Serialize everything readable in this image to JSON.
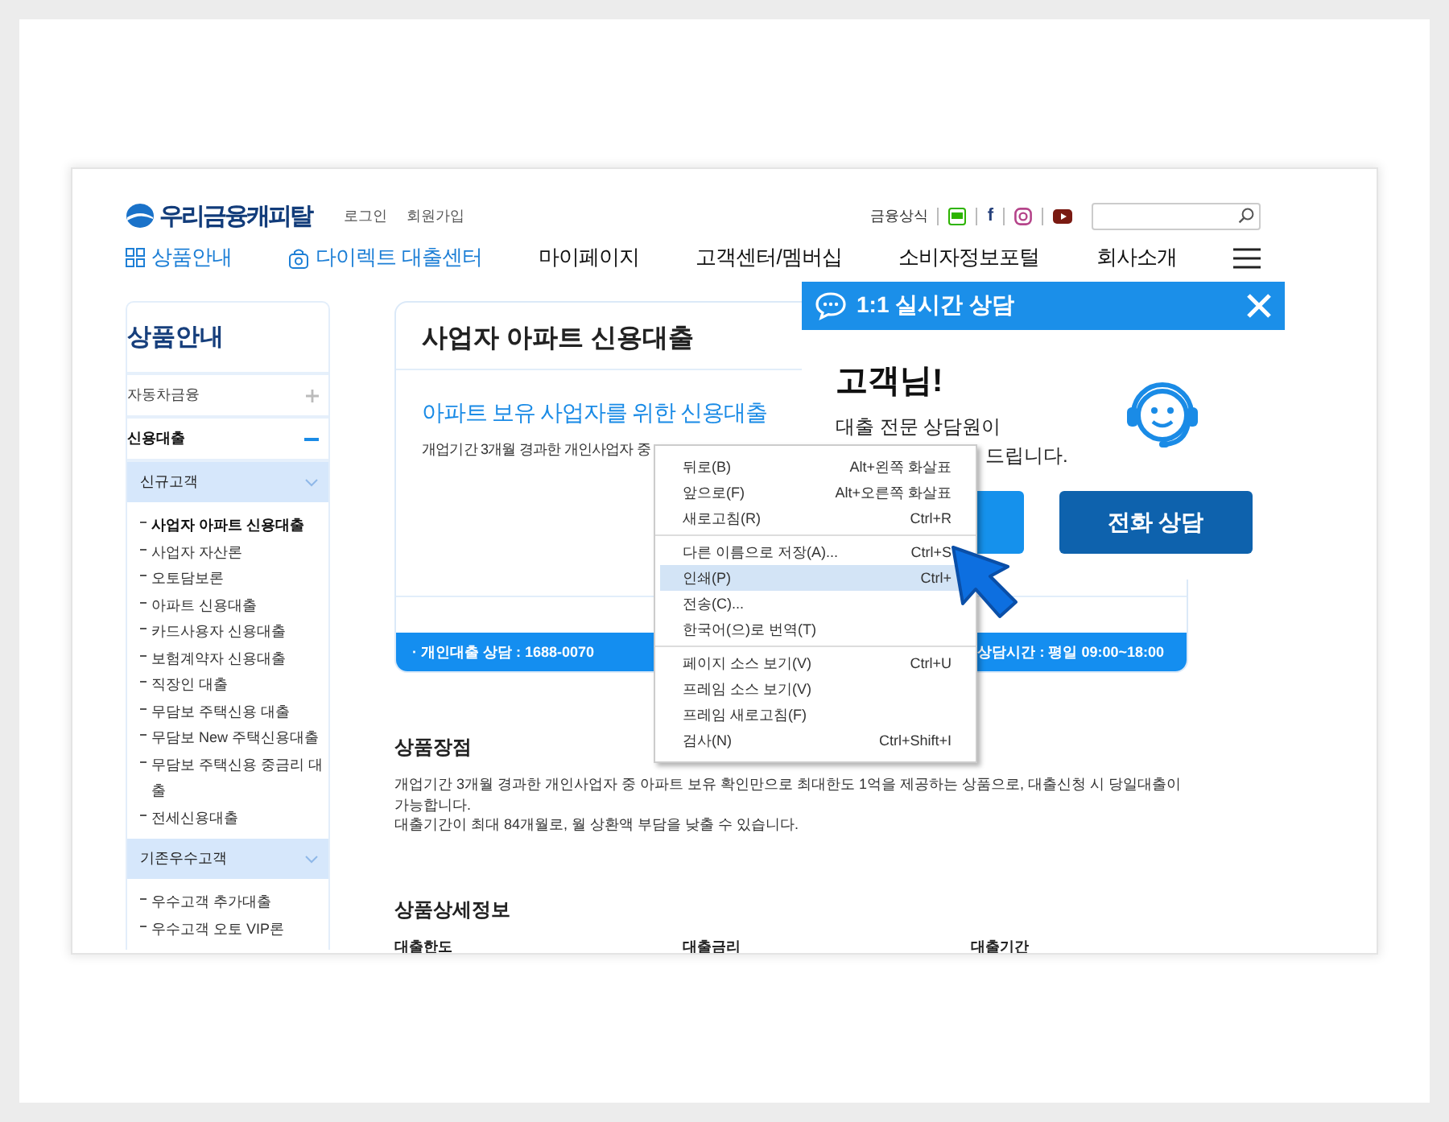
{
  "header": {
    "logo": "우리금융캐피탈",
    "links": [
      "로그인",
      "회원가입"
    ],
    "util_label": "금융상식",
    "social": [
      {
        "kind": "blog"
      },
      {
        "kind": "facebook",
        "glyph": "f"
      },
      {
        "kind": "instagram"
      },
      {
        "kind": "youtube"
      }
    ]
  },
  "nav": [
    {
      "label": "상품안내",
      "kind": "grid"
    },
    {
      "label": "다이렉트 대출센터",
      "kind": "bag"
    },
    {
      "label": "마이페이지",
      "kind": "plain"
    },
    {
      "label": "고객센터/멤버십",
      "kind": "plain"
    },
    {
      "label": "소비자정보포털",
      "kind": "plain"
    },
    {
      "label": "회사소개",
      "kind": "plain"
    }
  ],
  "sidebar": {
    "title": "상품안내",
    "groups": [
      {
        "label": "자동차금융",
        "expanded": false
      },
      {
        "label": "신용대출",
        "expanded": true,
        "children": [
          {
            "label": "신규고객",
            "expanded": true,
            "children": [
              {
                "label": "사업자 아파트 신용대출",
                "selected": true
              },
              {
                "label": "사업자 자산론",
                "selected": false
              },
              {
                "label": "오토담보론",
                "selected": false
              },
              {
                "label": "아파트 신용대출",
                "selected": false
              },
              {
                "label": "카드사용자 신용대출",
                "selected": false
              },
              {
                "label": "보험계약자 신용대출",
                "selected": false
              },
              {
                "label": "직장인 대출",
                "selected": false
              },
              {
                "label": "무담보 주택신용 대출",
                "selected": false
              },
              {
                "label": "무담보 New 주택신용대출",
                "selected": false
              },
              {
                "label": "무담보 주택신용 중금리 대출",
                "selected": false
              },
              {
                "label": "전세신용대출",
                "selected": false
              }
            ]
          },
          {
            "label": "기존우수고객",
            "expanded": true,
            "children": [
              {
                "label": "우수고객 추가대출",
                "selected": false
              },
              {
                "label": "우수고객 오토 VIP론",
                "selected": false
              }
            ]
          }
        ]
      }
    ]
  },
  "product": {
    "title": "사업자 아파트 신용대출",
    "subtitle": "아파트 보유 사업자를 위한 신용대출",
    "description": "개업기간 3개월 경과한 개인사업자 중",
    "footer_left": "· 개인대출 상담 : 1688-0070",
    "footer_right": "상담시간 : 평일 09:00~18:00"
  },
  "sections": [
    {
      "heading": "상품장점",
      "paragraphs": [
        "개업기간 3개월 경과한 개인사업자 중 아파트 보유 확인만으로 최대한도 1억을 제공하는 상품으로, 대출신청 시 당일대출이 가능합니다.",
        "대출기간이 최대 84개월로, 월 상환액 부담을 낮출 수 있습니다."
      ]
    },
    {
      "heading": "상품상세정보",
      "columns": [
        "대출한도",
        "대출금리",
        "대출기간"
      ]
    }
  ],
  "chat": {
    "title": "1:1 실시간 상담",
    "greeting": "고객님!",
    "lines": [
      "대출 전문 상담원이",
      "드립니다."
    ],
    "buttons": [
      {
        "kind": "chat"
      },
      {
        "kind": "phone",
        "label": "전화 상담"
      }
    ]
  },
  "context_menu": {
    "groups": [
      [
        {
          "label": "뒤로(B)",
          "shortcut": "Alt+왼쪽 화살표",
          "selected": false
        },
        {
          "label": "앞으로(F)",
          "shortcut": "Alt+오른쪽 화살표",
          "selected": false
        },
        {
          "label": "새로고침(R)",
          "shortcut": "Ctrl+R",
          "selected": false
        }
      ],
      [
        {
          "label": "다른 이름으로 저장(A)...",
          "shortcut": "Ctrl+S",
          "selected": false
        },
        {
          "label": "인쇄(P)",
          "shortcut": "Ctrl+",
          "selected": true
        },
        {
          "label": "전송(C)...",
          "selected": false
        },
        {
          "label": "한국어(으)로 번역(T)",
          "selected": false
        }
      ],
      [
        {
          "label": "페이지 소스 보기(V)",
          "shortcut": "Ctrl+U",
          "selected": false
        },
        {
          "label": "프레임 소스 보기(V)",
          "selected": false
        },
        {
          "label": "프레임 새로고침(F)",
          "selected": false
        },
        {
          "label": "검사(N)",
          "shortcut": "Ctrl+Shift+I",
          "selected": false
        }
      ]
    ]
  }
}
